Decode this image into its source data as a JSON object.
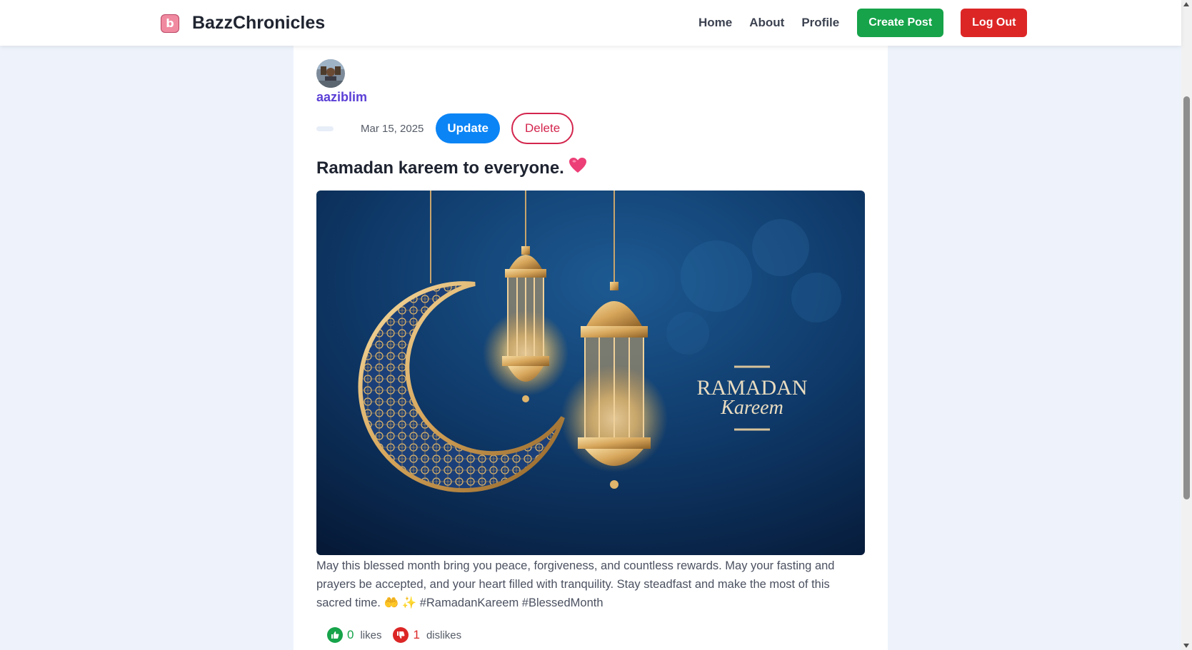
{
  "header": {
    "brand_name": "BazzChronicles",
    "logo_glyph": "b",
    "nav": [
      "Home",
      "About",
      "Profile"
    ],
    "create_post_label": "Create Post",
    "logout_label": "Log Out"
  },
  "post": {
    "author": "aaziblim",
    "date": "Mar 15, 2025",
    "update_label": "Update",
    "delete_label": "Delete",
    "title": "Ramadan kareem to everyone.",
    "title_emoji": "heart-icon",
    "image_text": {
      "line1": "RAMADAN",
      "line2": "Kareem"
    },
    "body": "May this blessed month bring you peace, forgiveness, and countless rewards. May your fasting and prayers be accepted, and your heart filled with tranquility. Stay steadfast and make the most of this sacred time. 🤲 ✨  #RamadanKareem #BlessedMonth",
    "likes": "0",
    "likes_label": "likes",
    "dislikes": "1",
    "dislikes_label": "dislikes"
  },
  "colors": {
    "brand_text": "#1f2430",
    "create_post": "#16a34a",
    "logout": "#dc2626",
    "update": "#0b84f5",
    "delete": "#d3254d",
    "author": "#5b3fd6"
  }
}
